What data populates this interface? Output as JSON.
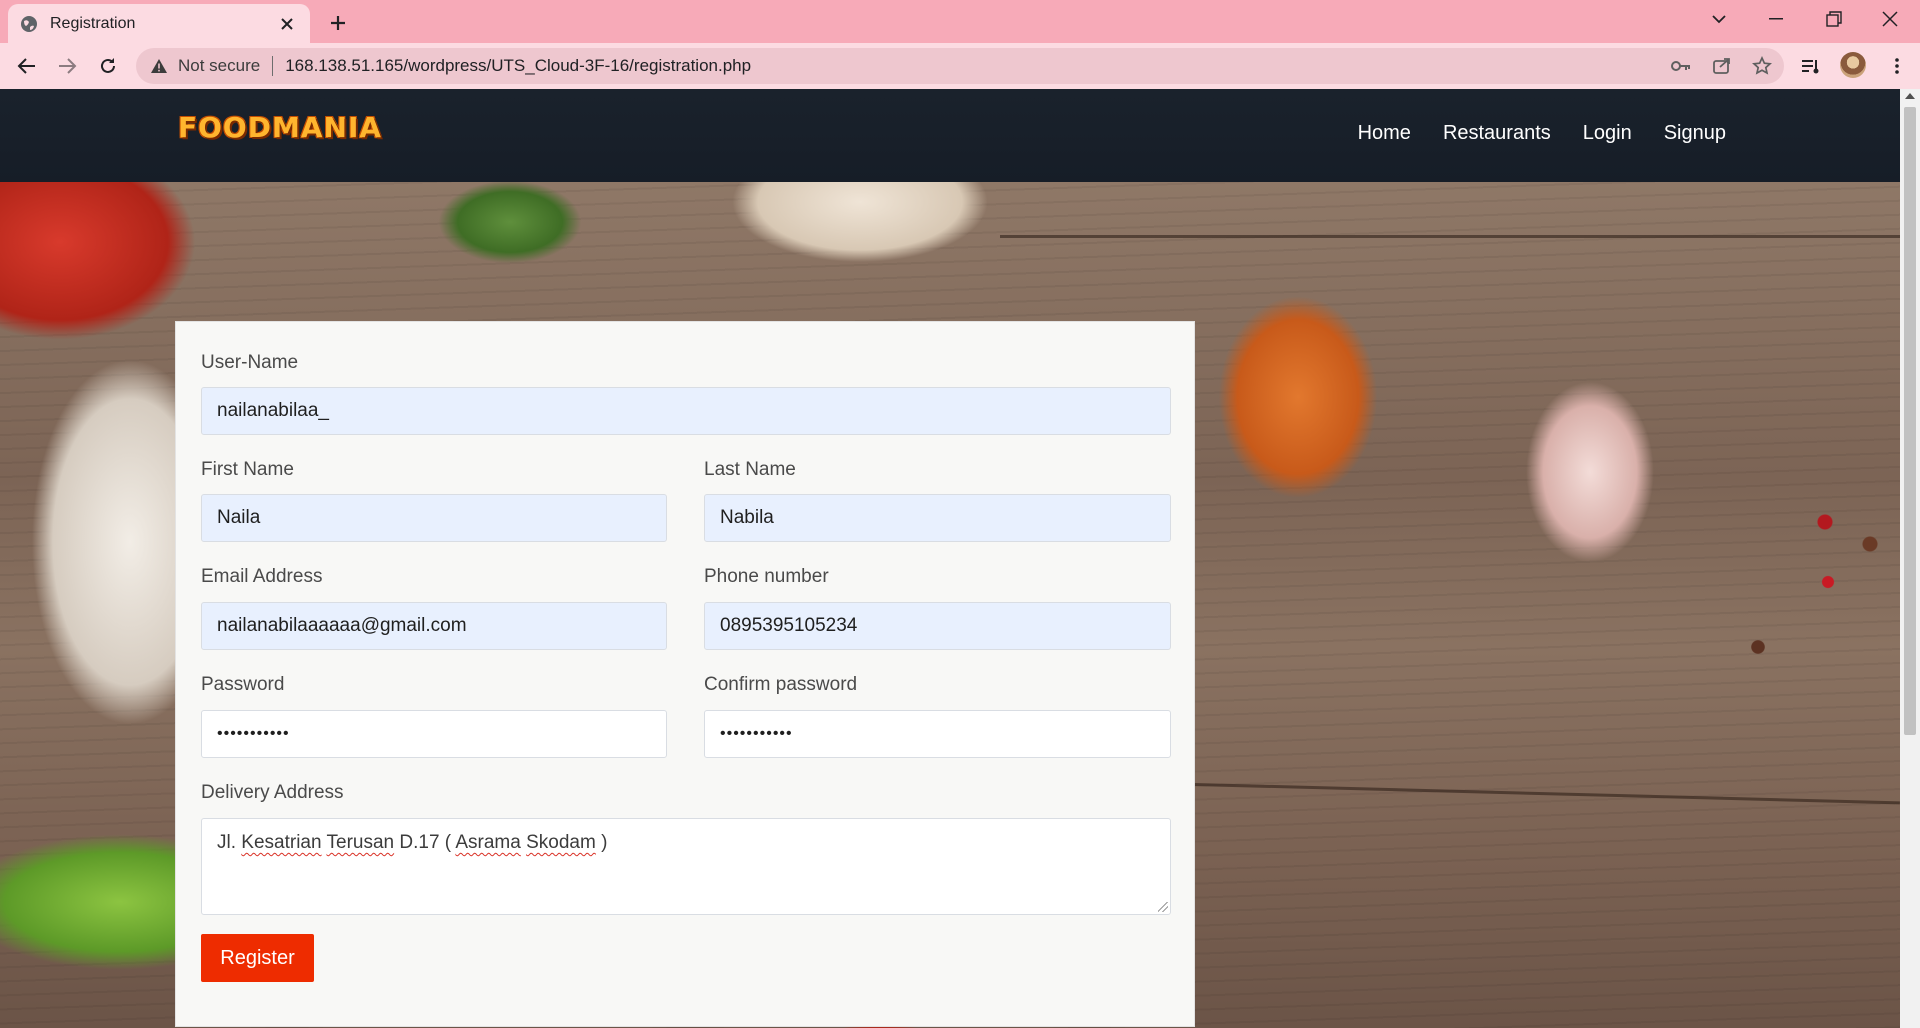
{
  "browser": {
    "tab_title": "Registration",
    "security_label": "Not secure",
    "url": "168.138.51.165/wordpress/UTS_Cloud-3F-16/registration.php"
  },
  "site": {
    "logo_text": "FOODMANIA",
    "nav": [
      "Home",
      "Restaurants",
      "Login",
      "Signup"
    ]
  },
  "form": {
    "username": {
      "label": "User-Name",
      "value": "nailanabilaa_"
    },
    "first_name": {
      "label": "First Name",
      "value": "Naila"
    },
    "last_name": {
      "label": "Last Name",
      "value": "Nabila"
    },
    "email": {
      "label": "Email Address",
      "value": "nailanabilaaaaaa@gmail.com"
    },
    "phone": {
      "label": "Phone number",
      "value": "0895395105234"
    },
    "password": {
      "label": "Password",
      "value": "•••••••••••"
    },
    "confirm_password": {
      "label": "Confirm password",
      "value": "•••••••••••"
    },
    "address": {
      "label": "Delivery Address",
      "value_parts": [
        "Jl. ",
        "Kesatrian",
        " ",
        "Terusan",
        " D.17 ( ",
        "Asrama",
        " ",
        "Skodam",
        " )"
      ]
    },
    "submit_label": "Register"
  },
  "colors": {
    "accent": "#ee2c00",
    "nav_bg": "#161d27",
    "autofill_bg": "#e8f0fe",
    "chrome_tab_bar": "#f7aab8"
  }
}
